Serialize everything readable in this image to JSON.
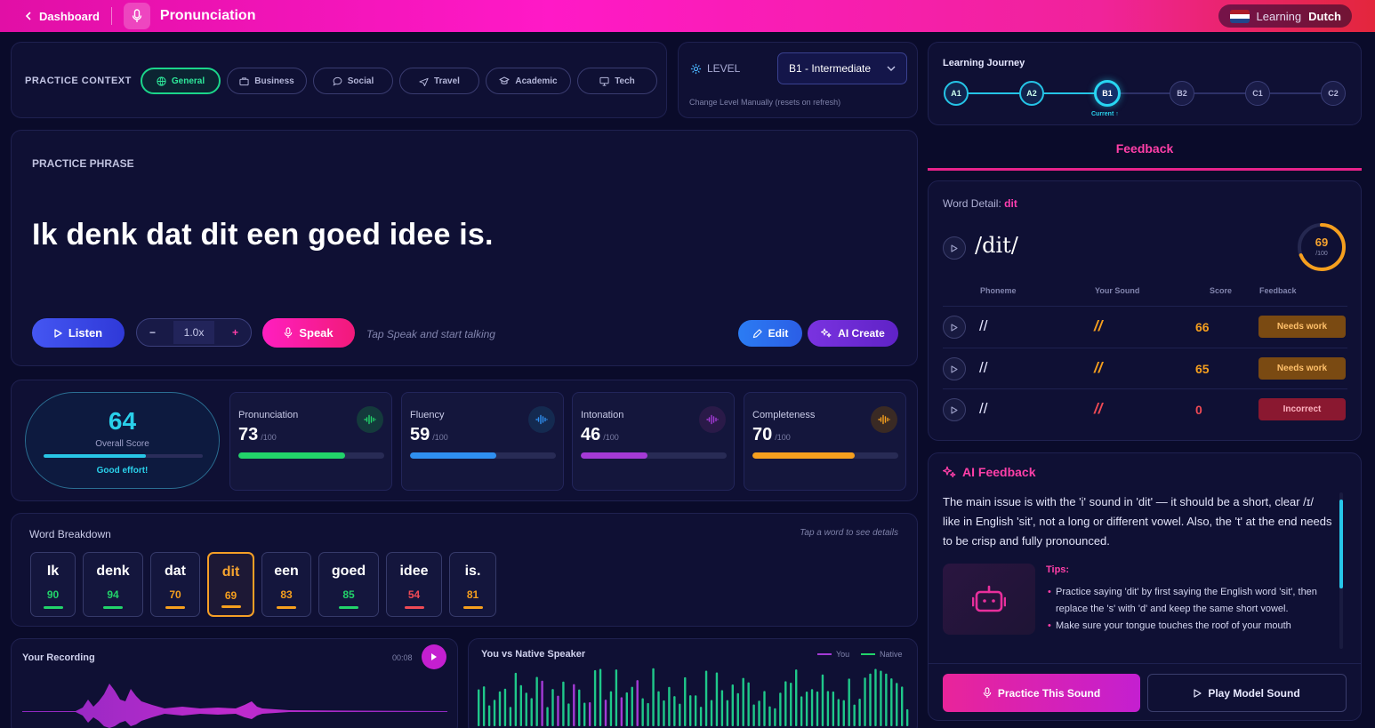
{
  "header": {
    "back_label": "Dashboard",
    "title": "Pronunciation",
    "learning_label": "Learning",
    "language": "Dutch"
  },
  "context": {
    "label": "PRACTICE CONTEXT",
    "chips": [
      {
        "label": "General",
        "icon": "globe-icon",
        "active": true
      },
      {
        "label": "Business",
        "icon": "briefcase-icon"
      },
      {
        "label": "Social",
        "icon": "chat-bubble-icon"
      },
      {
        "label": "Travel",
        "icon": "plane-icon"
      },
      {
        "label": "Academic",
        "icon": "graduation-cap-icon"
      },
      {
        "label": "Tech",
        "icon": "monitor-icon"
      }
    ]
  },
  "level": {
    "label": "LEVEL",
    "selected": "B1 - Intermediate",
    "hint": "Change Level Manually (resets on refresh)"
  },
  "phrase": {
    "label": "PRACTICE PHRASE",
    "text": "Ik denk dat dit een goed idee is.",
    "listen_label": "Listen",
    "speed_minus": "−",
    "speed_value": "1.0x",
    "speed_plus": "+",
    "speak_label": "Speak",
    "speak_hint": "Tap Speak and start talking",
    "edit_label": "Edit",
    "ai_create_label": "AI Create"
  },
  "scores": {
    "overall": {
      "value": "64",
      "label": "Overall Score",
      "message": "Good effort!",
      "fraction": 0.64
    },
    "metrics": [
      {
        "name": "Pronunciation",
        "value": "73",
        "max": "/100",
        "fraction": 0.73,
        "color": "#22d36a"
      },
      {
        "name": "Fluency",
        "value": "59",
        "max": "/100",
        "fraction": 0.59,
        "color": "#2f8ff0"
      },
      {
        "name": "Intonation",
        "value": "46",
        "max": "/100",
        "fraction": 0.46,
        "color": "#a43ad6"
      },
      {
        "name": "Completeness",
        "value": "70",
        "max": "/100",
        "fraction": 0.7,
        "color": "#f59f1e"
      }
    ]
  },
  "breakdown": {
    "title": "Word Breakdown",
    "hint": "Tap a word to see details",
    "words": [
      {
        "text": "Ik",
        "score": "90",
        "color": "#22d36a"
      },
      {
        "text": "denk",
        "score": "94",
        "color": "#22d36a"
      },
      {
        "text": "dat",
        "score": "70",
        "color": "#f59f1e"
      },
      {
        "text": "dit",
        "score": "69",
        "color": "#f59f1e",
        "selected": true
      },
      {
        "text": "een",
        "score": "83",
        "color": "#f59f1e"
      },
      {
        "text": "goed",
        "score": "85",
        "color": "#22d36a"
      },
      {
        "text": "idee",
        "score": "54",
        "color": "#ef4a55"
      },
      {
        "text": "is.",
        "score": "81",
        "color": "#f59f1e"
      }
    ]
  },
  "recording": {
    "title": "Your Recording",
    "time": "00:08"
  },
  "comparison": {
    "title": "You vs Native Speaker",
    "legend_you": "You",
    "legend_native": "Native"
  },
  "journey": {
    "title": "Learning Journey",
    "levels": [
      "A1",
      "A2",
      "B1",
      "B2",
      "C1",
      "C2"
    ],
    "current_index": 2,
    "current_label": "Current ↑"
  },
  "feedback_tab": "Feedback",
  "word_detail": {
    "label": "Word Detail:",
    "word": "dit",
    "ipa": "/dit/",
    "score": "69",
    "score_max": "/100",
    "score_fraction": 0.69,
    "headers": {
      "phoneme": "Phoneme",
      "your_sound": "Your Sound",
      "score": "Score",
      "feedback": "Feedback"
    },
    "rows": [
      {
        "phoneme": "//",
        "your_sound": "//",
        "score": "66",
        "feedback": "Needs work",
        "status": "warn"
      },
      {
        "phoneme": "//",
        "your_sound": "//",
        "score": "65",
        "feedback": "Needs work",
        "status": "warn"
      },
      {
        "phoneme": "//",
        "your_sound": "//",
        "score": "0",
        "feedback": "Incorrect",
        "status": "bad"
      }
    ]
  },
  "ai_feedback": {
    "title": "AI Feedback",
    "text": "The main issue is with the 'i' sound in 'dit' — it should be a short, clear /ɪ/ like in English 'sit', not a long or different vowel. Also, the 't' at the end needs to be crisp and fully pronounced.",
    "tips_title": "Tips:",
    "tips": [
      "Practice saying 'dit' by first saying the English word 'sit', then replace the 's' with 'd' and keep the same short vowel.",
      "Make sure your tongue touches the roof of your mouth"
    ],
    "practice_label": "Practice This Sound",
    "model_label": "Play Model Sound"
  },
  "colors": {
    "accent": "#ff19c7",
    "cyan": "#28d6f2",
    "green": "#22d36a",
    "orange": "#f59f1e",
    "red": "#ef4a55"
  }
}
